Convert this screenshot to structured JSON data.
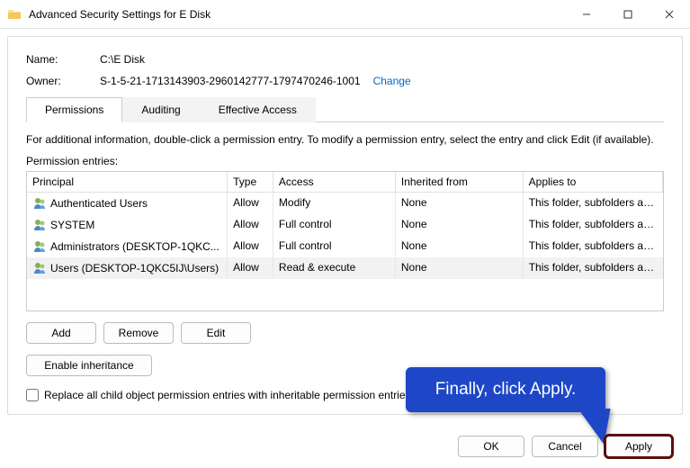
{
  "window": {
    "title": "Advanced Security Settings for E Disk"
  },
  "name_label": "Name:",
  "name_value": "C:\\E Disk",
  "owner_label": "Owner:",
  "owner_value": "S-1-5-21-1713143903-2960142777-1797470246-1001",
  "change_link": "Change",
  "tabs": {
    "permissions": "Permissions",
    "auditing": "Auditing",
    "effective": "Effective Access"
  },
  "info_text": "For additional information, double-click a permission entry. To modify a permission entry, select the entry and click Edit (if available).",
  "entries_label": "Permission entries:",
  "columns": {
    "principal": "Principal",
    "type": "Type",
    "access": "Access",
    "inherited": "Inherited from",
    "applies": "Applies to"
  },
  "rows": [
    {
      "principal": "Authenticated Users",
      "type": "Allow",
      "access": "Modify",
      "inherited": "None",
      "applies": "This folder, subfolders and files"
    },
    {
      "principal": "SYSTEM",
      "type": "Allow",
      "access": "Full control",
      "inherited": "None",
      "applies": "This folder, subfolders and files"
    },
    {
      "principal": "Administrators (DESKTOP-1QKC...",
      "type": "Allow",
      "access": "Full control",
      "inherited": "None",
      "applies": "This folder, subfolders and files"
    },
    {
      "principal": "Users (DESKTOP-1QKC5IJ\\Users)",
      "type": "Allow",
      "access": "Read & execute",
      "inherited": "None",
      "applies": "This folder, subfolders and files"
    }
  ],
  "buttons": {
    "add": "Add",
    "remove": "Remove",
    "edit": "Edit",
    "enable_inh": "Enable inheritance"
  },
  "checkbox_label": "Replace all child object permission entries with inheritable permission entries from this object",
  "footer": {
    "ok": "OK",
    "cancel": "Cancel",
    "apply": "Apply"
  },
  "callout": "Finally, click Apply."
}
